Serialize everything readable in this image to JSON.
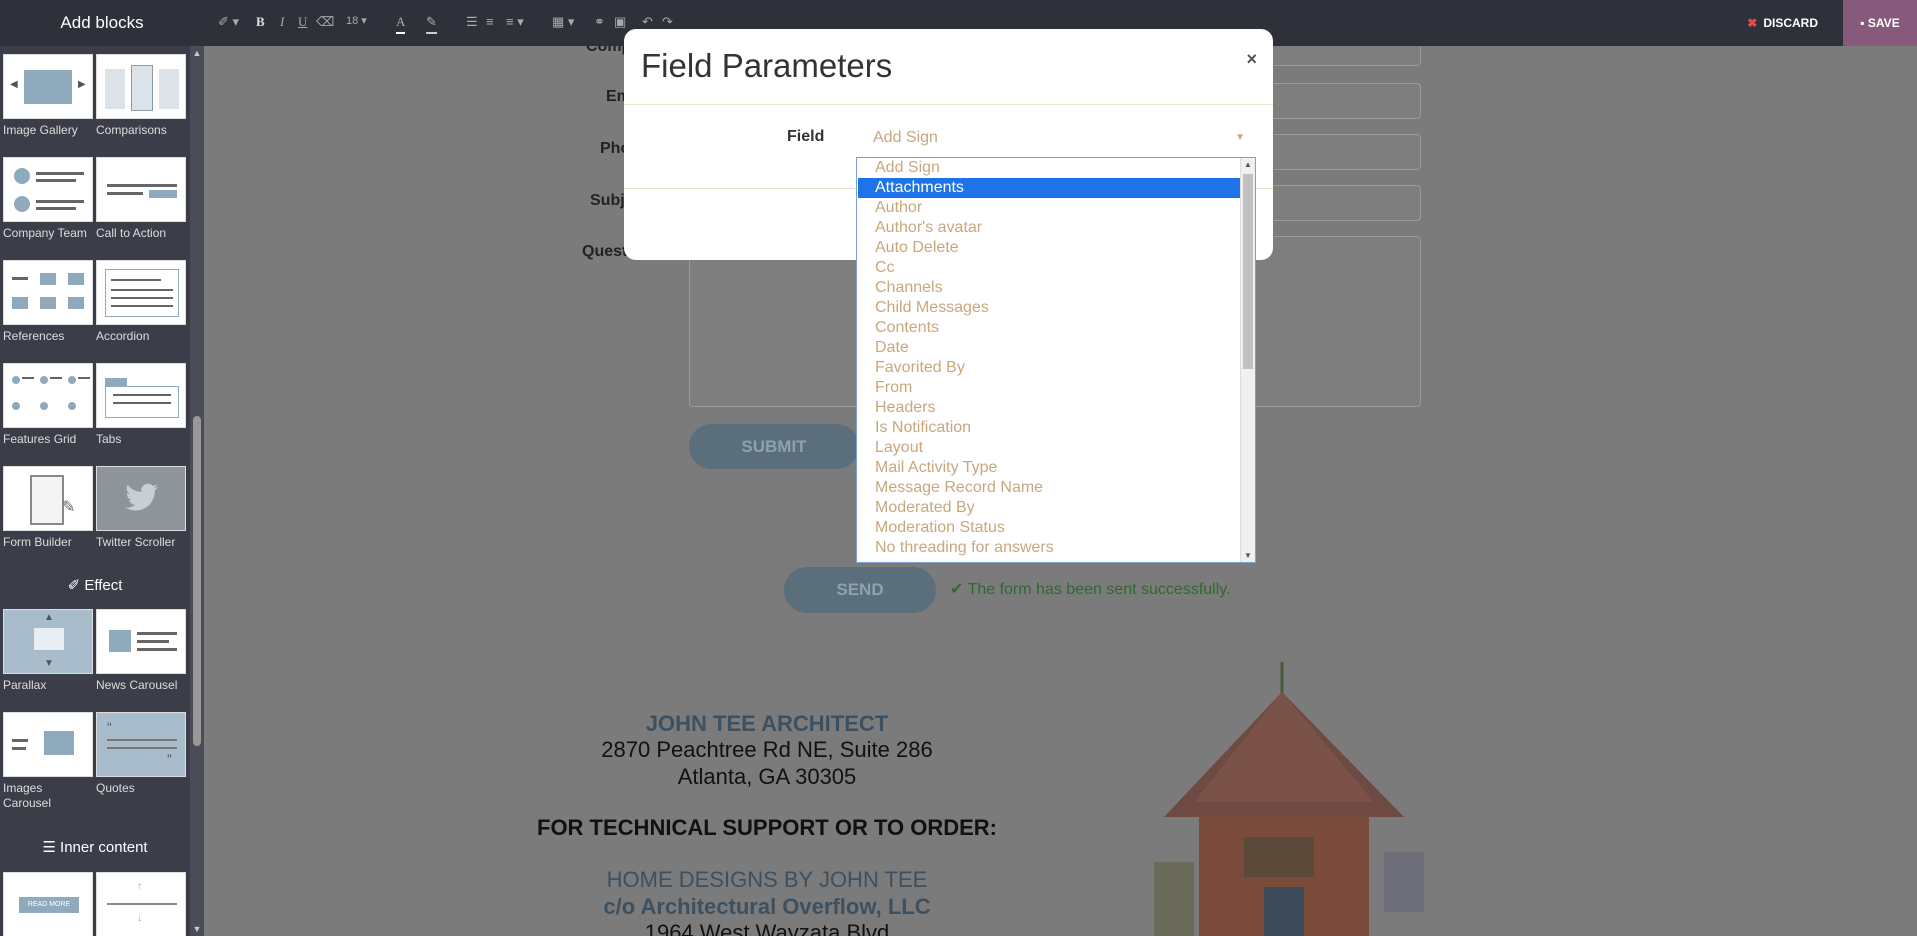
{
  "sidebar": {
    "title": "Add blocks",
    "snippets": [
      {
        "label": "Image Gallery"
      },
      {
        "label": "Comparisons"
      },
      {
        "label": "Company Team"
      },
      {
        "label": "Call to Action"
      },
      {
        "label": "References"
      },
      {
        "label": "Accordion"
      },
      {
        "label": "Features Grid"
      },
      {
        "label": "Tabs"
      },
      {
        "label": "Form Builder"
      },
      {
        "label": "Twitter Scroller"
      }
    ],
    "effect_title": "Effect",
    "effect_snippets": [
      {
        "label": "Parallax"
      },
      {
        "label": "News Carousel"
      },
      {
        "label": "Images Carousel"
      },
      {
        "label": "Quotes"
      }
    ],
    "inner_title": "Inner content",
    "inner_snippets": [
      {
        "label": "READ MORE"
      }
    ]
  },
  "toolbar": {
    "font_size": "18",
    "discard_label": "DISCARD",
    "save_label": "SAVE"
  },
  "page": {
    "labels": [
      "Comp",
      "Em",
      "Pho",
      "Subj",
      "Questi"
    ],
    "submit_label": "SUBMIT",
    "send_label": "SEND",
    "success_message": "The form has been sent successfully.",
    "address": {
      "company": "JOHN TEE ARCHITECT",
      "line1": "2870 Peachtree Rd NE, Suite 286",
      "line2": "Atlanta, GA 30305",
      "support": "FOR TECHNICAL SUPPORT OR TO ORDER:",
      "home": "HOME DESIGNS BY JOHN TEE",
      "co": "c/o Architectural Overflow, LLC",
      "street": "1964 West Wayzata Blvd"
    }
  },
  "modal": {
    "title": "Field Parameters",
    "close": "×",
    "field_label": "Field",
    "field_value": "Add Sign",
    "options": [
      "Add Sign",
      "Attachments",
      "Author",
      "Author's avatar",
      "Auto Delete",
      "Cc",
      "Channels",
      "Child Messages",
      "Contents",
      "Date",
      "Favorited By",
      "From",
      "Headers",
      "Is Notification",
      "Layout",
      "Mail Activity Type",
      "Message Record Name",
      "Moderated By",
      "Moderation Status",
      "No threading for answers"
    ],
    "selected_index": 1
  },
  "colors": {
    "accent": "#875a7b",
    "selected": "#1e73e8",
    "option_text": "#c9a77e"
  }
}
